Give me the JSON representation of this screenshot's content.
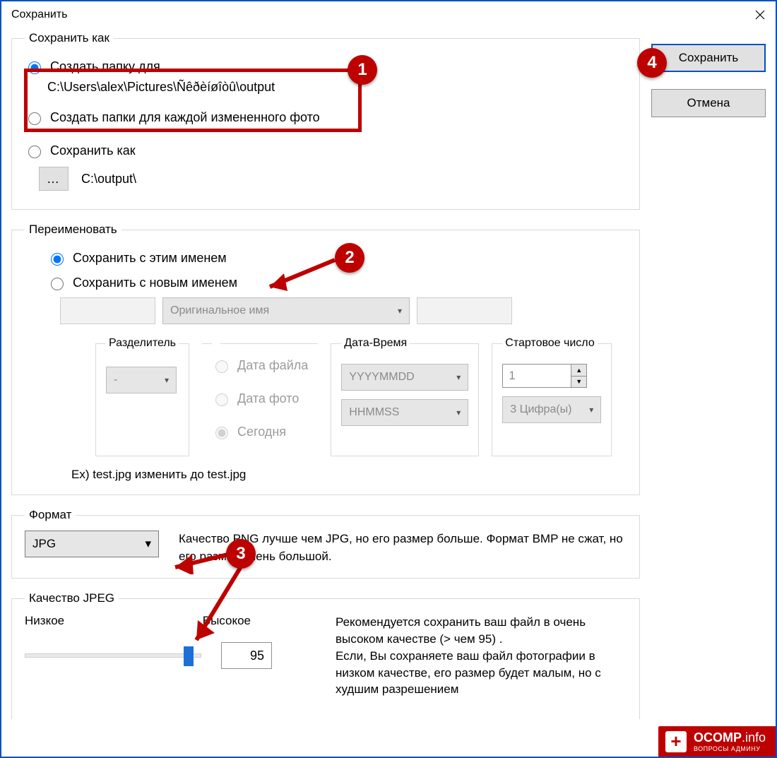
{
  "window": {
    "title": "Сохранить"
  },
  "buttons": {
    "save": "Сохранить",
    "cancel": "Отмена"
  },
  "save_as": {
    "legend": "Сохранить как",
    "opt_create_folder": "Создать папку для",
    "opt_create_folder_path": "C:\\Users\\alex\\Pictures\\Ñêðèíøîòû\\output",
    "opt_create_folders_each": "Создать папки для каждой измененного фото",
    "opt_save_as": "Сохранить как",
    "browse_dots": "…",
    "save_as_path": "C:\\output\\"
  },
  "rename": {
    "legend": "Переименовать",
    "opt_keep_name": "Сохранить с этим именем",
    "opt_new_name": "Сохранить с новым именем",
    "original_name_placeholder": "Оригинальное имя",
    "separator_legend": "Разделитель",
    "separator_value": "-",
    "date_file": "Дата файла",
    "date_photo": "Дата фото",
    "date_today": "Сегодня",
    "datetime_legend": "Дата-Время",
    "datetime_fmt_date": "YYYYMMDD",
    "datetime_fmt_time": "HHMMSS",
    "startnum_legend": "Стартовое число",
    "startnum_value": "1",
    "startnum_digits": "3 Цифра(ы)",
    "example_line": "Ex) test.jpg изменить до test.jpg"
  },
  "format": {
    "legend": "Формат",
    "selected": "JPG",
    "note": "Качество PNG лучше чем JPG, но его размер  больше. Формат BMP не сжат, но его размер  очень большой."
  },
  "quality": {
    "legend": "Качество JPEG",
    "low": "Низкое",
    "high": "Высокое",
    "value": "95",
    "note": "Рекомендуется сохранить ваш файл в  очень высоком качестве (> чем 95) .\nЕсли, Вы сохраняете ваш файл фотографии в низком качестве, его размер будет малым, но с худшим  разрешением"
  },
  "callouts": {
    "n1": "1",
    "n2": "2",
    "n3": "3",
    "n4": "4"
  },
  "watermark": {
    "brand": "OCOMP",
    "tld": ".info",
    "tagline": "ВОПРОСЫ АДМИНУ"
  }
}
